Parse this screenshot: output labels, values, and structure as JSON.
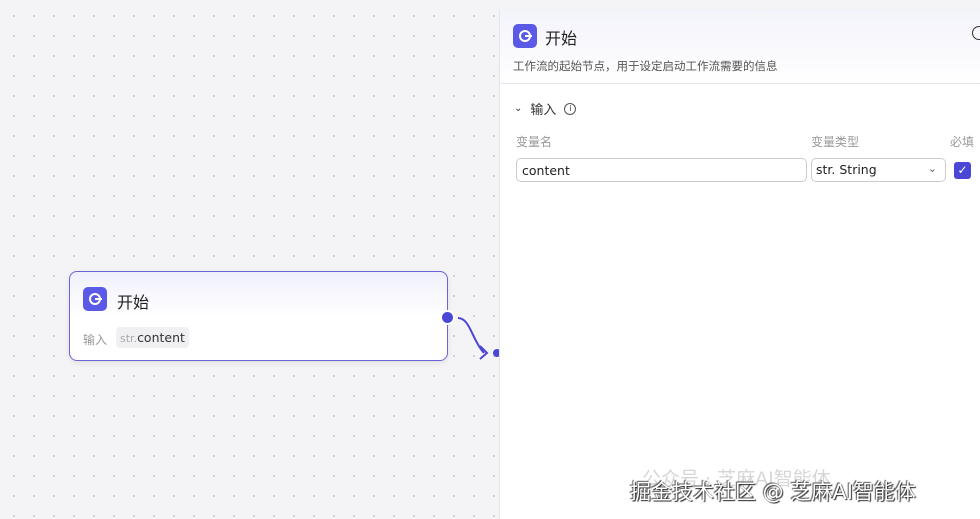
{
  "node": {
    "title": "开始",
    "input_label": "输入",
    "var_type": "str.",
    "var_name": "content"
  },
  "panel": {
    "title": "开始",
    "description": "工作流的起始节点，用于设定启动工作流需要的信息",
    "section": "输入",
    "columns": {
      "name": "变量名",
      "type": "变量类型",
      "required": "必填"
    },
    "row": {
      "name": "content",
      "type": "str. String",
      "required": true
    }
  },
  "watermark": {
    "faint": "公众号 · 芝麻AI智能体",
    "main": "掘金技术社区 @ 芝麻AI智能体"
  },
  "colors": {
    "accent": "#5a5ae6"
  }
}
